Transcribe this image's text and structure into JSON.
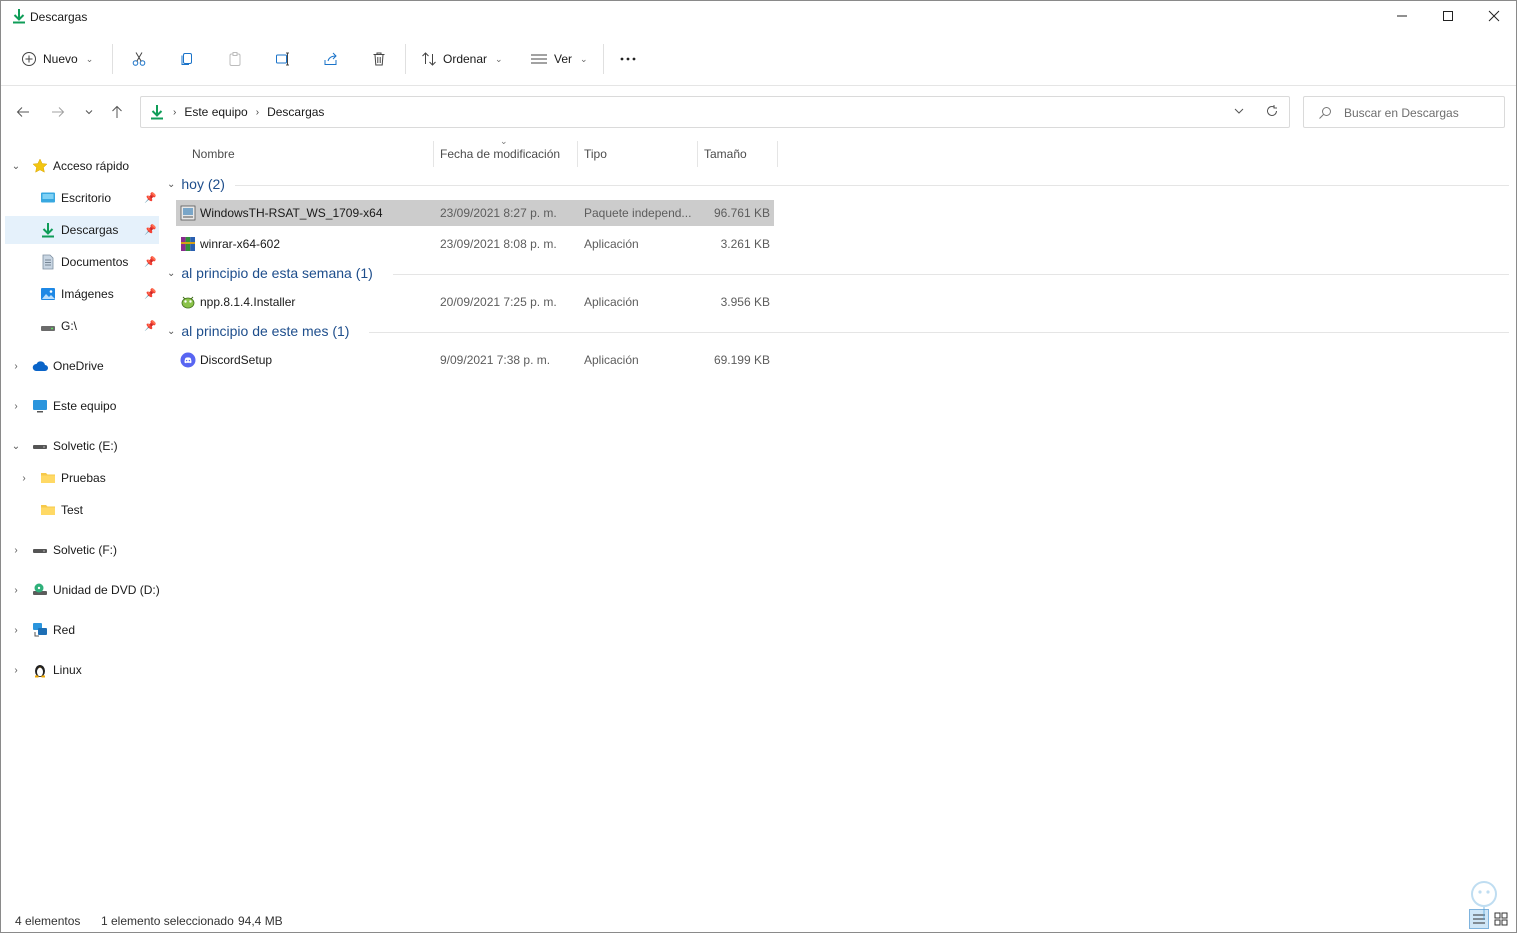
{
  "window": {
    "title": "Descargas"
  },
  "toolbar": {
    "new_label": "Nuevo",
    "sort_label": "Ordenar",
    "view_label": "Ver",
    "more_label": "..."
  },
  "address": {
    "crumbs": [
      "Este equipo",
      "Descargas"
    ]
  },
  "search": {
    "placeholder": "Buscar en Descargas"
  },
  "sidebar": {
    "items": [
      {
        "label": "Acceso rápido",
        "icon": "star-icon"
      },
      {
        "label": "Escritorio",
        "icon": "desktop-icon",
        "pinned": true
      },
      {
        "label": "Descargas",
        "icon": "download-icon",
        "pinned": true,
        "selected": true
      },
      {
        "label": "Documentos",
        "icon": "document-icon",
        "pinned": true
      },
      {
        "label": "Imágenes",
        "icon": "picture-icon",
        "pinned": true
      },
      {
        "label": "G:\\",
        "icon": "drive-icon",
        "pinned": true
      },
      {
        "label": "OneDrive",
        "icon": "cloud-icon"
      },
      {
        "label": "Este equipo",
        "icon": "computer-icon"
      },
      {
        "label": "Solvetic (E:)",
        "icon": "drive-icon"
      },
      {
        "label": "Pruebas",
        "icon": "folder-icon"
      },
      {
        "label": "Test",
        "icon": "folder-icon"
      },
      {
        "label": "Solvetic (F:)",
        "icon": "drive-icon"
      },
      {
        "label": "Unidad de DVD (D:)",
        "icon": "dvd-icon"
      },
      {
        "label": "Red",
        "icon": "network-icon"
      },
      {
        "label": "Linux",
        "icon": "linux-icon"
      }
    ]
  },
  "columns": {
    "name": "Nombre",
    "date": "Fecha de modificación",
    "type": "Tipo",
    "size": "Tamaño"
  },
  "groups": [
    {
      "label": "hoy (2)",
      "files": [
        {
          "name": "WindowsTH-RSAT_WS_1709-x64",
          "date": "23/09/2021 8:27 p. m.",
          "type": "Paquete independ...",
          "size": "96.761 KB",
          "icon": "package-icon",
          "selected": true
        },
        {
          "name": "winrar-x64-602",
          "date": "23/09/2021 8:08 p. m.",
          "type": "Aplicación",
          "size": "3.261 KB",
          "icon": "winrar-icon"
        }
      ]
    },
    {
      "label": "al principio de esta semana (1)",
      "files": [
        {
          "name": "npp.8.1.4.Installer",
          "date": "20/09/2021 7:25 p. m.",
          "type": "Aplicación",
          "size": "3.956 KB",
          "icon": "notepadpp-icon"
        }
      ]
    },
    {
      "label": "al principio de este mes (1)",
      "files": [
        {
          "name": "DiscordSetup",
          "date": "9/09/2021 7:38 p. m.",
          "type": "Aplicación",
          "size": "69.199 KB",
          "icon": "discord-icon"
        }
      ]
    }
  ],
  "status": {
    "count": "4 elementos",
    "selection": "1 elemento seleccionado",
    "selection_size": "94,4 MB"
  },
  "colors": {
    "accent": "#0078d4",
    "group": "#1e4e8c",
    "selection": "#cccccc",
    "nav_selection": "#e5f1fb"
  }
}
